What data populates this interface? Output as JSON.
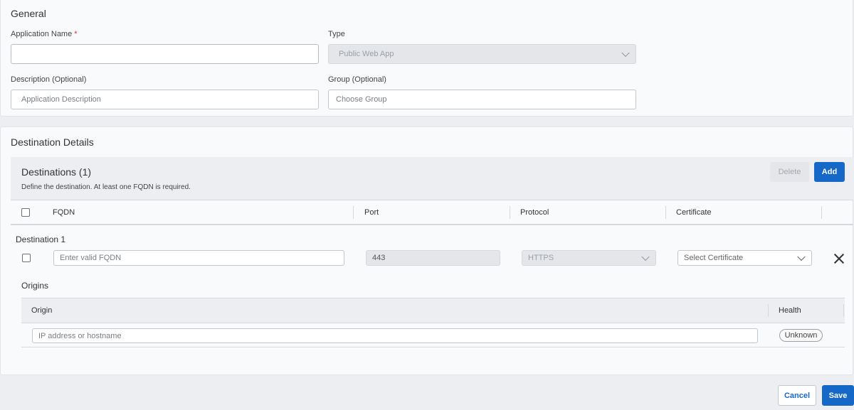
{
  "general": {
    "title": "General",
    "app_name_label": "Application Name",
    "required_mark": "*",
    "app_name_value": "",
    "type_label": "Type",
    "type_value": "Public Web App",
    "description_label": "Description (Optional)",
    "description_placeholder": "Application Description",
    "group_label": "Group (Optional)",
    "group_placeholder": "Choose Group"
  },
  "destination_details": {
    "title": "Destination Details",
    "destinations_title": "Destinations (1)",
    "destinations_subtitle": "Define the destination. At least one FQDN is required.",
    "delete_label": "Delete",
    "add_label": "Add",
    "columns": [
      "FQDN",
      "Port",
      "Protocol",
      "Certificate"
    ],
    "destination": {
      "name": "Destination 1",
      "fqdn_placeholder": "Enter valid FQDN",
      "port_value": "443",
      "protocol_value": "HTTPS",
      "certificate_placeholder": "Select Certificate",
      "remove_icon": "close-icon"
    },
    "origins": {
      "title": "Origins",
      "columns": [
        "Origin",
        "Health"
      ],
      "origin_placeholder": "IP address or hostname",
      "health_value": "Unknown"
    }
  },
  "footer": {
    "cancel_label": "Cancel",
    "save_label": "Save"
  },
  "colors": {
    "primary": "#1668c8",
    "required": "#d9342b"
  }
}
